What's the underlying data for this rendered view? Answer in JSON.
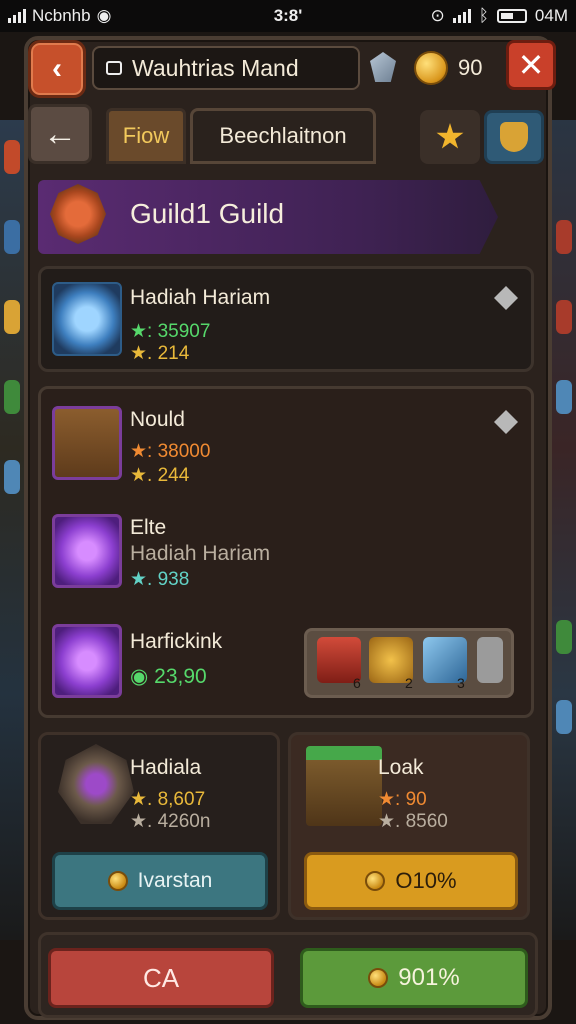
{
  "status_bar": {
    "carrier": "Ncbnhb",
    "time": "3:8'",
    "right_text": "04M"
  },
  "header": {
    "title": "Wauhtrias Mand",
    "coins": "90",
    "back_icon": "chevron-left-icon",
    "close_icon": "close-icon"
  },
  "tabs": [
    {
      "label": "Fiow"
    },
    {
      "label": "Beechlaitnon"
    }
  ],
  "guild": {
    "title": "Guild1 Guild"
  },
  "cards": {
    "hariam": {
      "name": "Hadiah Hariam",
      "stat1": "★: 35907",
      "stat2": "★. 214"
    },
    "nould": {
      "name": "Nould",
      "stat1": "★: 38000",
      "stat2": "★. 244"
    },
    "elte": {
      "name": "Elte",
      "subtitle": "Hadiah Hariam",
      "stat1": "★. 938"
    },
    "harfickink": {
      "name": "Harfickink",
      "stat1": "23,90"
    },
    "items": [
      "6",
      "2",
      "3"
    ]
  },
  "bottom": {
    "left": {
      "name": "Hadiala",
      "stat1": "★. 8,607",
      "stat2": "★. 4260n",
      "button": "Ivarstan"
    },
    "right": {
      "name": "Loak",
      "stat1": "★: 90",
      "stat2": "★. 8560",
      "button": "O10%"
    }
  },
  "footer": {
    "left_button": "CA",
    "right_button": "901%"
  },
  "colors": {
    "accent_purple": "#5a2b72",
    "gold": "#d99b1f",
    "teal": "#3c7680",
    "red": "#b8453c",
    "green": "#5c9a3b"
  }
}
